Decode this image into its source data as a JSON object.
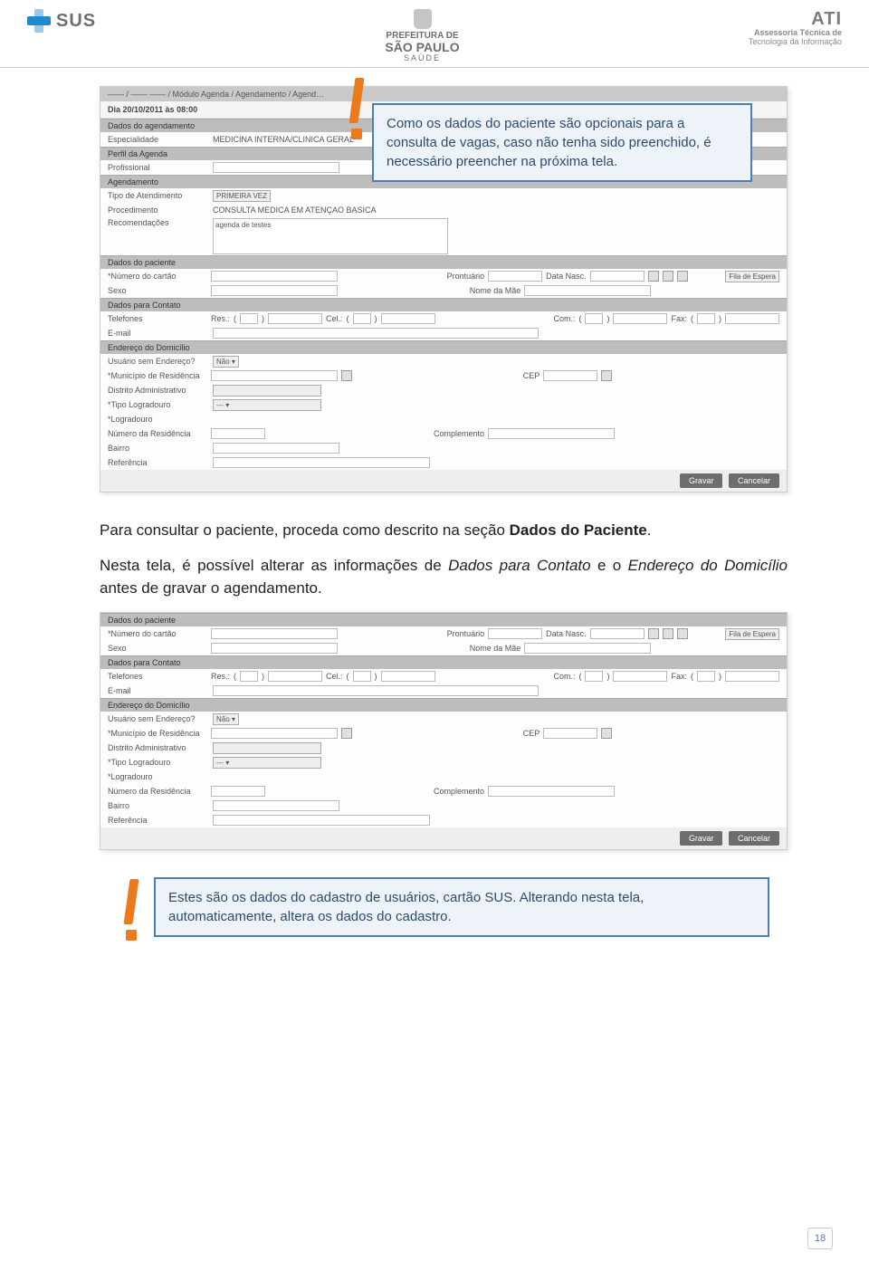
{
  "header": {
    "sus_label": "SUS",
    "prefeitura_line1": "PREFEITURA DE",
    "prefeitura_line2": "SÃO PAULO",
    "prefeitura_line3": "SAÚDE",
    "ati_label": "ATI",
    "ati_line1": "Assessoria Técnica de",
    "ati_line2": "Tecnologia da Informação"
  },
  "screenshot1": {
    "breadcrumb": "—— / —— —— / Módulo Agenda / Agendamento / Agend…",
    "datetime": "Dia 20/10/2011 às 08:00",
    "sec_agendamento": "Dados do agendamento",
    "lbl_especialidade": "Especialidade",
    "val_especialidade": "MEDICINA INTERNA/CLINICA GERAL",
    "sec_perfil": "Perfil da Agenda",
    "lbl_profissional": "Profissional",
    "sec_agend": "Agendamento",
    "lbl_tipo_atend": "Tipo de Atendimento",
    "val_tipo_atend": "PRIMEIRA VEZ",
    "lbl_procedimento": "Procedimento",
    "val_procedimento": "CONSULTA MEDICA EM ATENÇAO BASICA",
    "lbl_recomend": "Recomendações",
    "val_recomend": "agenda de testes",
    "sec_paciente": "Dados do paciente",
    "lbl_num_cartao": "*Número do cartão",
    "lbl_prontuario": "Prontuário",
    "lbl_data_nasc": "Data Nasc.",
    "lbl_fila": "Fila de Espera",
    "lbl_sexo": "Sexo",
    "lbl_nome_mae": "Nome da Mãe",
    "sec_contato": "Dados para Contato",
    "lbl_telefones": "Telefones",
    "lbl_res": "Res.:",
    "lbl_cel": "Cel.:",
    "lbl_com": "Com.:",
    "lbl_fax": "Fax:",
    "lbl_email": "E-mail",
    "sec_endereco": "Endereço do Domicílio",
    "lbl_sem_endereco": "Usuário sem Endereço?",
    "val_sem_endereco": "Não ▾",
    "lbl_municipio": "*Município de Residência",
    "lbl_cep": "CEP",
    "lbl_distrito": "Distrito Administrativo",
    "lbl_tipo_log": "*Tipo Logradouro",
    "val_tipo_log": "--- ▾",
    "lbl_logradouro": "*Logradouro",
    "lbl_num_res": "Número da Residência",
    "lbl_complemento": "Complemento",
    "lbl_bairro": "Bairro",
    "lbl_referencia": "Referência",
    "btn_gravar": "Gravar",
    "btn_cancelar": "Cancelar"
  },
  "callout1": "Como os dados do paciente são opcionais para a consulta de vagas, caso não tenha sido preenchido, é necessário preencher na próxima tela.",
  "para1_a": "Para consultar o paciente, proceda como descrito na seção ",
  "para1_b": "Dados do Paciente",
  "para1_c": ".",
  "para2_a": "Nesta tela, é possível alterar as informações de ",
  "para2_b": "Dados para Contato",
  "para2_c": " e o ",
  "para2_d": "Endereço do Domicílio",
  "para2_e": " antes de gravar o agendamento.",
  "callout2": "Estes são os dados do cadastro de usuários, cartão SUS. Alterando nesta tela, automaticamente, altera os dados do cadastro.",
  "page_number": "18"
}
